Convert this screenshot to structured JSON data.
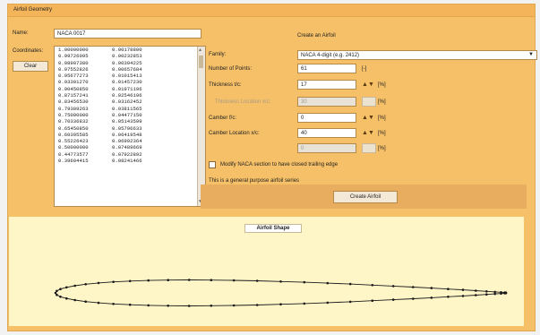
{
  "window": {
    "title": "Airfoil Geometry"
  },
  "left": {
    "name_label": "Name:",
    "name_value": "NACA 0017",
    "coords_label": "Coordinates:",
    "clear_label": "Clear",
    "coordinates": [
      [
        "1.00000000",
        "0.00178800"
      ],
      [
        "0.99726095",
        "0.00232853"
      ],
      [
        "0.98907380",
        "0.00394225"
      ],
      [
        "0.97552826",
        "0.00657684"
      ],
      [
        "0.95677273",
        "0.01015413"
      ],
      [
        "0.93301270",
        "0.01457230"
      ],
      [
        "0.90450850",
        "0.01971196"
      ],
      [
        "0.87157241",
        "0.02546196"
      ],
      [
        "0.83456530",
        "0.03162452"
      ],
      [
        "0.79389263",
        "0.03811565"
      ],
      [
        "0.75000000",
        "0.04477150"
      ],
      [
        "0.70336832",
        "0.05143599"
      ],
      [
        "0.65450850",
        "0.05796633"
      ],
      [
        "0.60395585",
        "0.06419548"
      ],
      [
        "0.55226423",
        "0.06992364"
      ],
      [
        "0.50000000",
        "0.07489669"
      ],
      [
        "0.44773577",
        "0.07922892"
      ],
      [
        "0.39604415",
        "0.08241466"
      ]
    ]
  },
  "right": {
    "heading": "Create an Airfoil",
    "family_label": "Family:",
    "family_value": "NACA 4-digit (e.g. 2412)",
    "points_label": "Number of Points:",
    "points_value": "61",
    "points_unit": "[-]",
    "thickness_label": "Thickness  t/c:",
    "thickness_value": "17",
    "unit_pct": "[%]",
    "thickness_location_label": "Thickness Location  x/c:",
    "thickness_location_value": "30",
    "camber_label": "Camber  f/c:",
    "camber_value": "0",
    "camber_location_label": "Camber Location  x/c:",
    "camber_location_value": "40",
    "extra_value": "0",
    "checkbox_label": "Modify NACA section to have closed trailing edge",
    "description": "This is a general purpose airfoil series",
    "create_button": "Create Airfoil"
  },
  "shape": {
    "title": "Airfoil Shape",
    "curve_color": "#1a1a1a",
    "thickness_ratio": 0.17,
    "points": 61
  }
}
